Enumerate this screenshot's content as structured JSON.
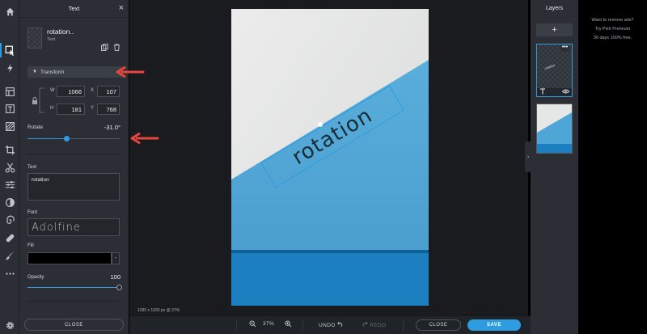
{
  "panel": {
    "title": "Text",
    "close_glyph": "×",
    "layer_name": "rotation..",
    "layer_type": "Text",
    "transform_label": "Transform",
    "w_label": "W",
    "w_value": "1066",
    "h_label": "H",
    "h_value": "181",
    "x_label": "X",
    "x_value": "107",
    "y_label": "Y",
    "y_value": "768",
    "rotate_label": "Rotate",
    "rotate_value": "-31.0°",
    "text_label": "Text",
    "text_value": "rotation",
    "font_label": "Font",
    "font_value": "Adolfine",
    "fill_label": "Fill",
    "fill_color": "#000000",
    "fill_menu": "-",
    "opacity_label": "Opacity",
    "opacity_value": "100",
    "close_label": "CLOSE"
  },
  "canvas": {
    "overlay_text": "rotation",
    "info": "1280 x 1920 px @ 37%"
  },
  "bottombar": {
    "zoom": "37%",
    "undo": "UNDO",
    "redo": "REDO",
    "close": "CLOSE",
    "save": "SAVE"
  },
  "layers": {
    "title": "Layers",
    "add": "+",
    "text_layer_thumb_text": "rotation",
    "menu_glyph": "•••"
  },
  "ad": {
    "line1": "Want to remove ads?",
    "line2": "Try Pixlr Premium",
    "line3": "30 days 100% free."
  },
  "colors": {
    "accent": "#2d9de0",
    "panel_bg": "#2b2f35",
    "canvas_bg": "#191b1f",
    "paper_top": "#e7e8e8",
    "paper_blue": "#4ea6d6",
    "deep_blue": "#1c7fc0",
    "annotation_red": "#e8453c"
  },
  "icons": [
    "home-icon",
    "arrange-icon",
    "magic-icon",
    "layout-icon",
    "text-tool-icon",
    "texture-icon",
    "crop-icon",
    "cut-icon",
    "adjust-icon",
    "filter-icon",
    "liquify-icon",
    "heal-icon",
    "brush-icon",
    "more-icon",
    "settings-icon"
  ]
}
